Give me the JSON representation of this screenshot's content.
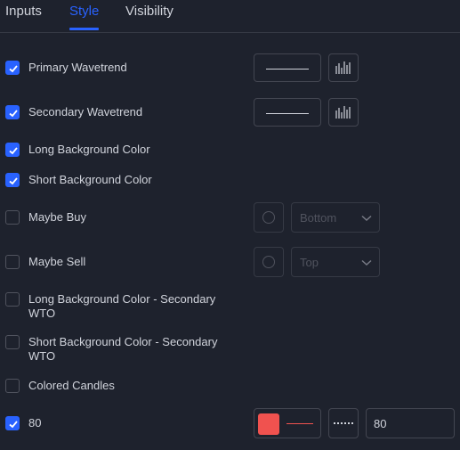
{
  "tabs": [
    {
      "label": "Inputs",
      "active": false
    },
    {
      "label": "Style",
      "active": true
    },
    {
      "label": "Visibility",
      "active": false
    }
  ],
  "rows": [
    {
      "label": "Primary Wavetrend",
      "checked": true
    },
    {
      "label": "Secondary Wavetrend",
      "checked": true
    },
    {
      "label": "Long Background Color",
      "checked": true
    },
    {
      "label": "Short Background Color",
      "checked": true
    },
    {
      "label": "Maybe Buy",
      "checked": false,
      "location": "Bottom"
    },
    {
      "label": "Maybe Sell",
      "checked": false,
      "location": "Top"
    },
    {
      "label": "Long Background Color - Secondary WTO",
      "checked": false
    },
    {
      "label": "Short Background Color - Secondary WTO",
      "checked": false
    },
    {
      "label": "Colored Candles",
      "checked": false
    },
    {
      "label": "80",
      "checked": true,
      "color": "#f0524f",
      "value": "80"
    }
  ],
  "colors": {
    "accent": "#2962ff",
    "line_red": "#f0524f",
    "background": "#1e222d"
  },
  "icons": {
    "plot_type": "histogram-icon",
    "line_style": "dotted-line-icon",
    "dropdown": "chevron-down-icon",
    "checkbox": "check-icon"
  }
}
